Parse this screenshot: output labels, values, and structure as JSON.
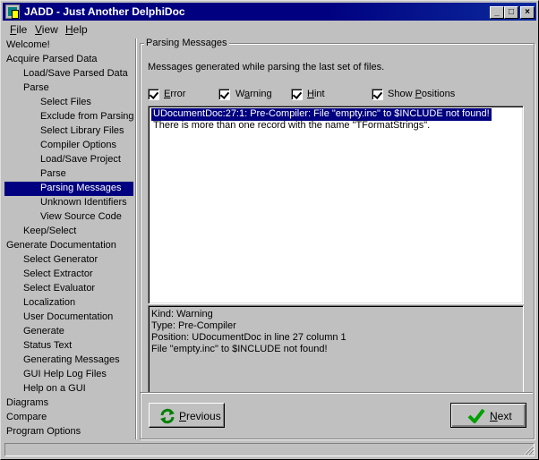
{
  "window": {
    "title": "JADD - Just Another DelphiDoc"
  },
  "menu": [
    {
      "label": "File",
      "accel": "F"
    },
    {
      "label": "View",
      "accel": "V"
    },
    {
      "label": "Help",
      "accel": "H"
    }
  ],
  "tree": [
    {
      "label": "Welcome!",
      "level": 0,
      "selected": false
    },
    {
      "label": "Acquire Parsed Data",
      "level": 0,
      "selected": false
    },
    {
      "label": "Load/Save Parsed Data",
      "level": 1,
      "selected": false
    },
    {
      "label": "Parse",
      "level": 1,
      "selected": false
    },
    {
      "label": "Select Files",
      "level": 2,
      "selected": false
    },
    {
      "label": "Exclude from Parsing",
      "level": 2,
      "selected": false
    },
    {
      "label": "Select Library Files",
      "level": 2,
      "selected": false
    },
    {
      "label": "Compiler Options",
      "level": 2,
      "selected": false
    },
    {
      "label": "Load/Save Project",
      "level": 2,
      "selected": false
    },
    {
      "label": "Parse",
      "level": 2,
      "selected": false
    },
    {
      "label": "Parsing Messages",
      "level": 2,
      "selected": true
    },
    {
      "label": "Unknown Identifiers",
      "level": 2,
      "selected": false
    },
    {
      "label": "View Source Code",
      "level": 2,
      "selected": false
    },
    {
      "label": "Keep/Select",
      "level": 1,
      "selected": false
    },
    {
      "label": "Generate Documentation",
      "level": 0,
      "selected": false
    },
    {
      "label": "Select Generator",
      "level": 1,
      "selected": false
    },
    {
      "label": "Select Extractor",
      "level": 1,
      "selected": false
    },
    {
      "label": "Select Evaluator",
      "level": 1,
      "selected": false
    },
    {
      "label": "Localization",
      "level": 1,
      "selected": false
    },
    {
      "label": "User Documentation",
      "level": 1,
      "selected": false
    },
    {
      "label": "Generate",
      "level": 1,
      "selected": false
    },
    {
      "label": "Status Text",
      "level": 1,
      "selected": false
    },
    {
      "label": "Generating Messages",
      "level": 1,
      "selected": false
    },
    {
      "label": "GUI Help Log Files",
      "level": 1,
      "selected": false
    },
    {
      "label": "Help on a GUI",
      "level": 1,
      "selected": false
    },
    {
      "label": "Diagrams",
      "level": 0,
      "selected": false
    },
    {
      "label": "Compare",
      "level": 0,
      "selected": false
    },
    {
      "label": "Program Options",
      "level": 0,
      "selected": false
    }
  ],
  "page": {
    "group_title": "Parsing Messages",
    "description": "Messages generated while parsing the last set of files.",
    "filters": [
      {
        "before": "",
        "underline": "E",
        "after": "rror",
        "checked": true
      },
      {
        "before": "W",
        "underline": "a",
        "after": "rning",
        "checked": true
      },
      {
        "before": "",
        "underline": "H",
        "after": "int",
        "checked": true
      },
      {
        "before": "Show ",
        "underline": "P",
        "after": "ositions",
        "checked": true
      }
    ],
    "messages": [
      {
        "text": "UDocumentDoc:27:1: Pre-Compiler: File \"empty.inc\" to $INCLUDE not found!",
        "selected": true
      },
      {
        "text": "There is more than one record with the name \"TFormatStrings\".",
        "selected": false
      }
    ],
    "details": {
      "kind": "Kind: Warning",
      "type": "Type: Pre-Compiler",
      "position": "Position: UDocumentDoc in line 27 column 1",
      "message": "File \"empty.inc\" to $INCLUDE not found!"
    },
    "previous": {
      "underline": "P",
      "rest": "revious"
    },
    "next": {
      "underline": "N",
      "rest": "ext"
    }
  },
  "colors": {
    "titlebar": "#000080",
    "selection": "#000080",
    "face": "#c0c0c0",
    "check_green": "#00a000"
  }
}
